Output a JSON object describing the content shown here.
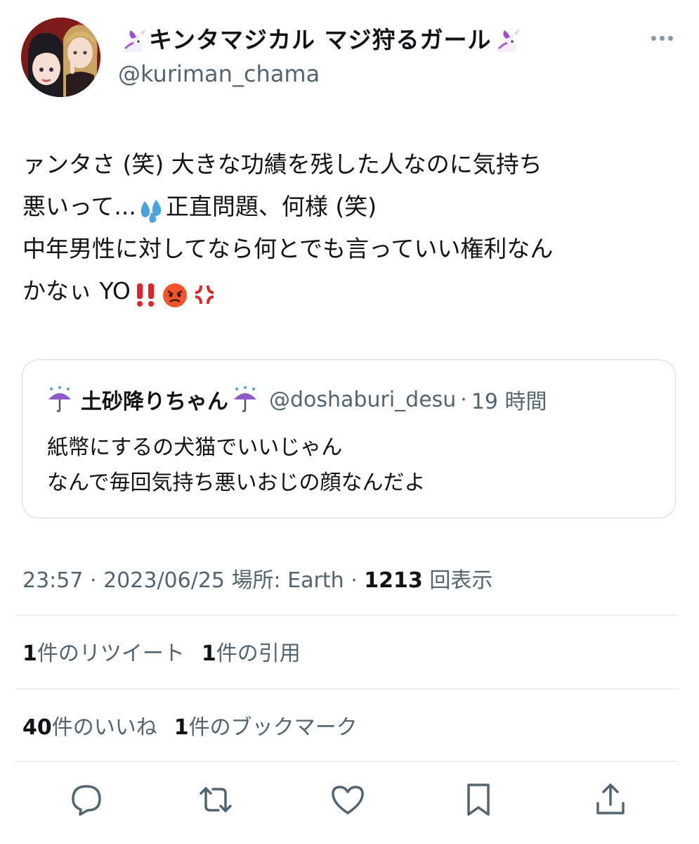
{
  "author": {
    "display_name": "キンタマジカル マジ狩るガール",
    "handle": "@kuriman_chama"
  },
  "tweet": {
    "lines": [
      "ァンタさ (笑) 大きな功績を残した人なのに気持ち",
      "悪いって...",
      "正直問題、何様 (笑)",
      "中年男性に対してなら何とでも言っていい権利なん",
      "かなぃ YO"
    ]
  },
  "quote": {
    "name": "土砂降りちゃん",
    "handle": "@doshaburi_desu",
    "time": "19 時間",
    "lines": [
      "紙幣にするの犬猫でいいじゃん",
      "なんで毎回気持ち悪いおじの顔なんだよ"
    ]
  },
  "meta": {
    "time": "23:57",
    "date": "2023/06/25",
    "location": "場所: Earth",
    "views_count": "1213",
    "views_label": "回表示"
  },
  "stats": {
    "retweets_count": "1",
    "retweets_label": "件のリツイート",
    "quotes_count": "1",
    "quotes_label": "件の引用",
    "likes_count": "40",
    "likes_label": "件のいいね",
    "bookmarks_count": "1",
    "bookmarks_label": "件のブックマーク"
  },
  "icons": [
    "unicorn-emoji-icon",
    "pink-heart-emoji-icon",
    "more-icon",
    "sweat-droplets-emoji-icon",
    "double-exclamation-emoji-icon",
    "angry-face-emoji-icon",
    "anger-symbol-emoji-icon",
    "umbrella-rain-emoji-icon",
    "reply-icon",
    "retweet-icon",
    "like-icon",
    "bookmark-icon",
    "share-icon"
  ],
  "colors": {
    "text": "#0f1419",
    "secondary": "#536471",
    "border": "#cfd9de",
    "icon": "#536471"
  }
}
